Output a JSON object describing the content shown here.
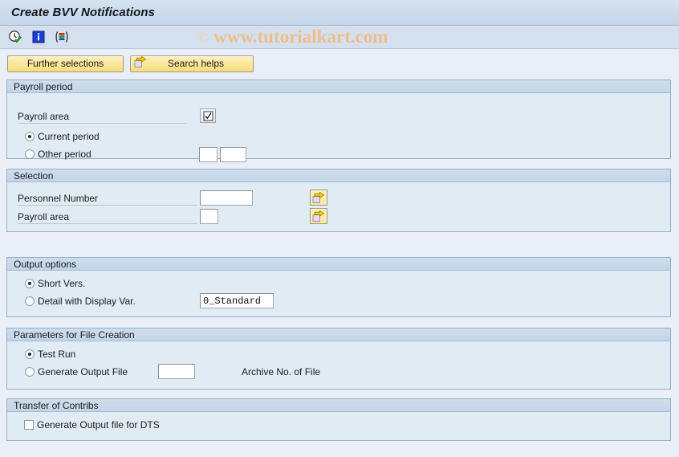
{
  "window": {
    "title": "Create BVV Notifications"
  },
  "toolbar": {
    "icons": [
      {
        "name": "execute-clock-icon",
        "title": "Execute"
      },
      {
        "name": "information-icon",
        "title": "Information"
      },
      {
        "name": "variants-icon",
        "title": "Get Variant"
      }
    ]
  },
  "watermark": {
    "copyright": "©",
    "text": "www.tutorialkart.com"
  },
  "buttons": {
    "further_selections": "Further selections",
    "search_helps": "Search helps"
  },
  "sections": {
    "payroll_period": {
      "title": "Payroll period",
      "payroll_area_label": "Payroll area",
      "current_period": "Current period",
      "other_period": "Other period",
      "other_period_value_1": "",
      "other_period_value_2": "",
      "selected": "current_period"
    },
    "selection": {
      "title": "Selection",
      "personnel_number_label": "Personnel Number",
      "personnel_number_value": "",
      "payroll_area_label": "Payroll area",
      "payroll_area_value": ""
    },
    "output_options": {
      "title": "Output options",
      "short_vers": "Short Vers.",
      "detail_with_display_var": "Detail with Display Var.",
      "display_var_value": "0_Standard",
      "selected": "short_vers"
    },
    "file_creation": {
      "title": "Parameters for File Creation",
      "test_run": "Test Run",
      "generate_output_file": "Generate Output File",
      "archive_no_value": "",
      "archive_no_label": "Archive No. of File",
      "selected": "test_run"
    },
    "transfer_contribs": {
      "title": "Transfer of Contribs",
      "generate_output_file_dts": "Generate Output file for DTS",
      "checked": false
    }
  },
  "colors": {
    "title_bar": "#cdddee",
    "panel_body": "#e1ebf4",
    "panel_head": "#c8d9ea",
    "button_yellow": "#f9e79f",
    "watermark": "#f0bc86",
    "page_bg": "#eaeff7"
  }
}
